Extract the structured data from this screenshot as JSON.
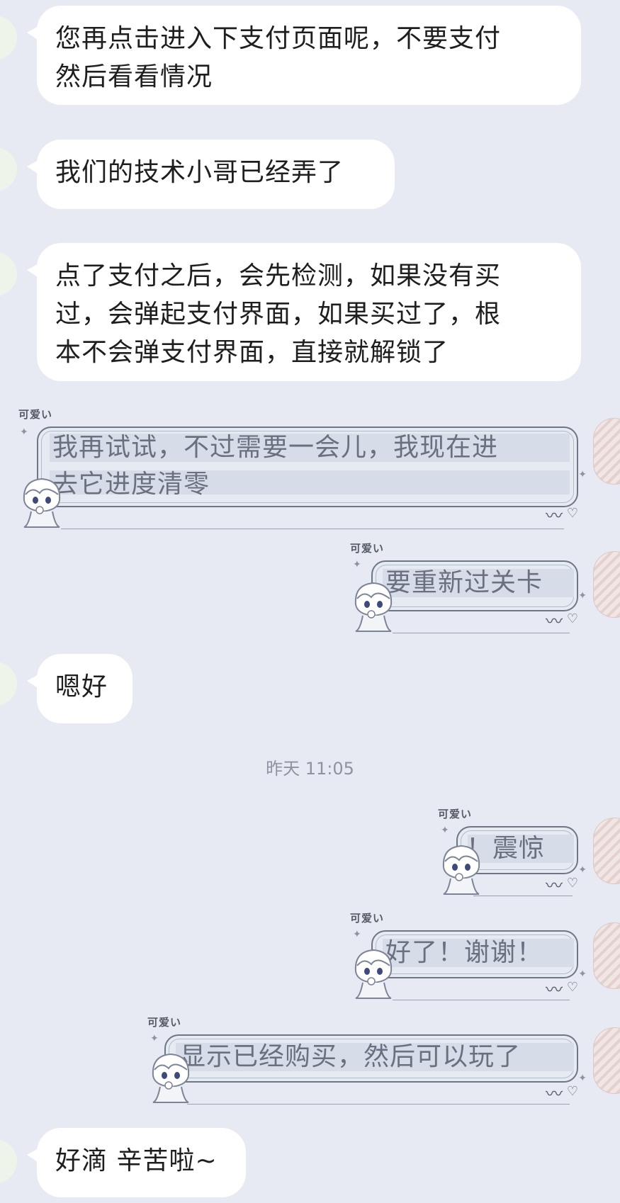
{
  "messages": [
    {
      "side": "left",
      "text": "您再点击进入下支付页面呢，不要支付\n然后看看情况"
    },
    {
      "side": "left",
      "text": "我们的技术小哥已经弄了"
    },
    {
      "side": "left",
      "text": "点了支付之后，会先检测，如果没有买\n过，会弹起支付界面，如果买过了，根\n本不会弹支付界面，直接就解锁了"
    },
    {
      "side": "right",
      "tag": "可爱い",
      "text": "我再试试，不过需要一会儿，我现在进\n去它进度清零"
    },
    {
      "side": "right",
      "tag": "可爱い",
      "text": "要重新过关卡"
    },
    {
      "side": "left",
      "text": "嗯好"
    },
    {
      "side": "right",
      "tag": "可爱い",
      "text": "！震惊"
    },
    {
      "side": "right",
      "tag": "可爱い",
      "text": "好了！谢谢！"
    },
    {
      "side": "right",
      "tag": "可爱い",
      "text": "显示已经购买，然后可以玩了"
    },
    {
      "side": "left",
      "text": "好滴 辛苦啦~"
    }
  ],
  "timestamp": "昨天 11:05",
  "icons": {
    "wave": "heartbeat-wave-icon",
    "heart": "heart-icon",
    "sparkle": "sparkle-icon",
    "sticker": "chibi-character-sticker"
  },
  "colors": {
    "background": "#e7eaf2",
    "left_bubble": "#ffffff",
    "right_frame": "#6f7685",
    "right_text": "#6a7080"
  }
}
